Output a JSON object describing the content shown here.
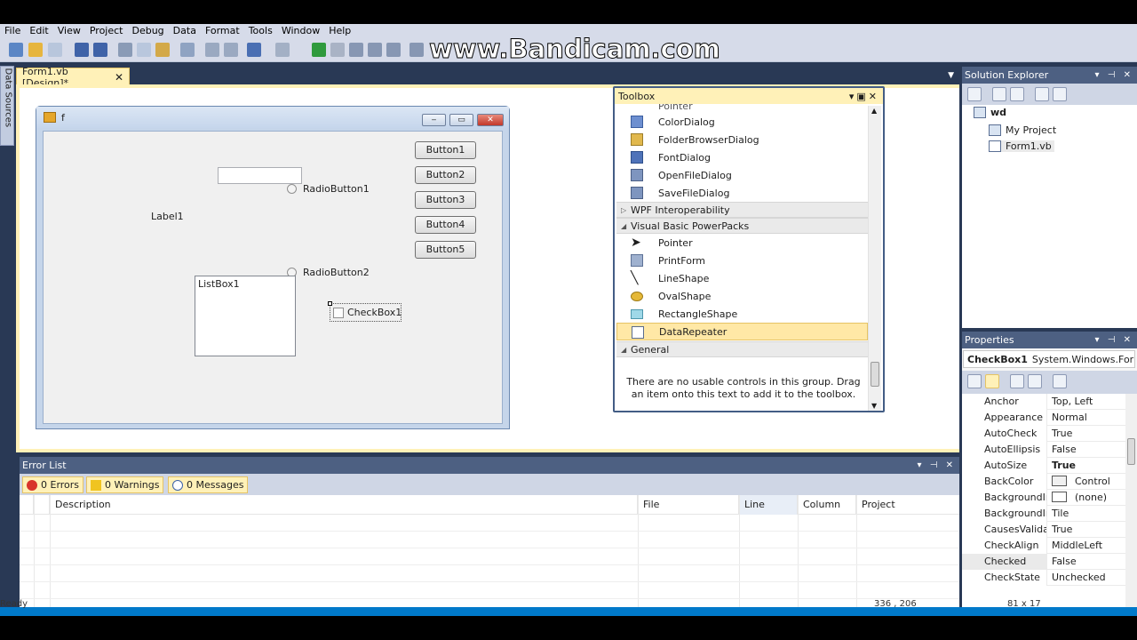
{
  "menu": [
    "File",
    "Edit",
    "View",
    "Project",
    "Debug",
    "Data",
    "Format",
    "Tools",
    "Window",
    "Help"
  ],
  "watermark": "www.Bandicam.com",
  "data_sources_tab": "Data Sources",
  "doc_tab": {
    "label": "Form1.vb [Design]*",
    "close": "✕"
  },
  "form": {
    "title": "f",
    "buttons": [
      "Button1",
      "Button2",
      "Button3",
      "Button4",
      "Button5"
    ],
    "radio1": "RadioButton1",
    "radio2": "RadioButton2",
    "label1": "Label1",
    "listbox": "ListBox1",
    "checkbox": "CheckBox1"
  },
  "toolbox": {
    "title": "Toolbox",
    "clipped_item": "Pointer",
    "dialog_items": [
      "ColorDialog",
      "FolderBrowserDialog",
      "FontDialog",
      "OpenFileDialog",
      "SaveFileDialog"
    ],
    "group_wpf": "WPF Interoperability",
    "group_vb": "Visual Basic PowerPacks",
    "vb_items": [
      "Pointer",
      "PrintForm",
      "LineShape",
      "OvalShape",
      "RectangleShape",
      "DataRepeater"
    ],
    "group_general": "General",
    "empty_text": "There are no usable controls in this group. Drag an item onto this text to add it to the toolbox."
  },
  "solution_explorer": {
    "title": "Solution Explorer",
    "root": "wd",
    "children": [
      "My Project",
      "Form1.vb"
    ]
  },
  "properties": {
    "title": "Properties",
    "object_name": "CheckBox1",
    "object_type": "System.Windows.Form",
    "rows": [
      {
        "name": "Anchor",
        "value": "Top, Left"
      },
      {
        "name": "Appearance",
        "value": "Normal"
      },
      {
        "name": "AutoCheck",
        "value": "True"
      },
      {
        "name": "AutoEllipsis",
        "value": "False"
      },
      {
        "name": "AutoSize",
        "value": "True"
      },
      {
        "name": "BackColor",
        "value": "Control"
      },
      {
        "name": "BackgroundIm",
        "value": "(none)"
      },
      {
        "name": "BackgroundIm",
        "value": "Tile"
      },
      {
        "name": "CausesValidati",
        "value": "True"
      },
      {
        "name": "CheckAlign",
        "value": "MiddleLeft"
      },
      {
        "name": "Checked",
        "value": "False"
      },
      {
        "name": "CheckState",
        "value": "Unchecked"
      }
    ]
  },
  "error_list": {
    "title": "Error List",
    "errors": "0 Errors",
    "warnings": "0 Warnings",
    "messages": "0 Messages",
    "columns": [
      "Description",
      "File",
      "Line",
      "Column",
      "Project"
    ]
  },
  "status": {
    "ready": "Ready",
    "position": "336 , 206",
    "size": "81 x 17"
  },
  "colors": {
    "chrome": "#293955",
    "tab_active": "#fff1b8",
    "selection": "#ffe8a6",
    "accent": "#0079ca"
  }
}
